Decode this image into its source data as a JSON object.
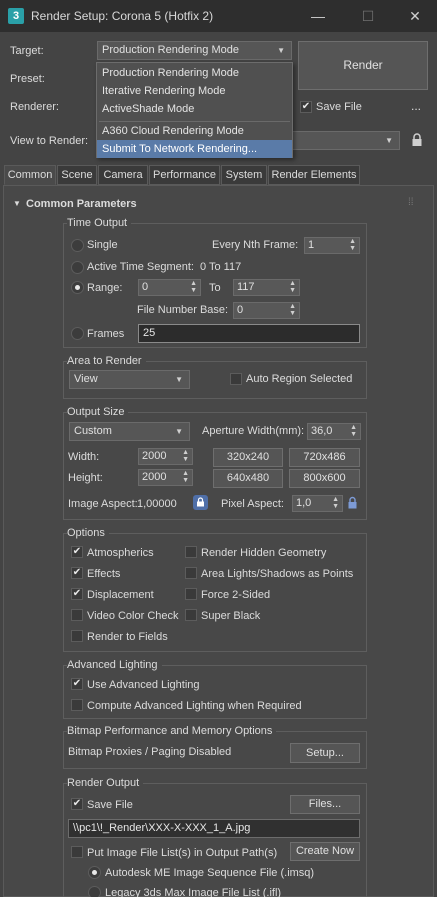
{
  "window": {
    "icon_glyph": "3",
    "title": "Render Setup: Corona 5 (Hotfix 2)",
    "minimize": "—",
    "maximize": "☐",
    "close": "✕"
  },
  "header": {
    "target_label": "Target:",
    "target_value": "Production Rendering Mode",
    "preset_label": "Preset:",
    "renderer_label": "Renderer:",
    "view_label": "View to Render:",
    "render_button": "Render",
    "save_file_label": "Save File",
    "save_file_checked": true,
    "more_label": "..."
  },
  "target_menu": {
    "items": [
      "Production Rendering Mode",
      "Iterative Rendering Mode",
      "ActiveShade Mode",
      "A360 Cloud Rendering Mode",
      "Submit To Network Rendering..."
    ],
    "selected_index": 4
  },
  "tabs": [
    "Common",
    "Scene",
    "Camera",
    "Performance",
    "System",
    "Render Elements"
  ],
  "active_tab": 0,
  "rollout": {
    "title": "Common Parameters",
    "toggle": "▼"
  },
  "time_output": {
    "title": "Time Output",
    "single": "Single",
    "every_nth_label": "Every Nth Frame:",
    "every_nth_value": "1",
    "active_segment": "Active Time Segment:",
    "active_segment_range": "0 To 117",
    "range": "Range:",
    "range_from": "0",
    "range_to_label": "To",
    "range_to": "117",
    "file_number_base_label": "File Number Base:",
    "file_number_base": "0",
    "frames": "Frames",
    "frames_value": "25",
    "selected": "range"
  },
  "area_to_render": {
    "title": "Area to Render",
    "mode": "View",
    "auto_region": "Auto Region Selected",
    "auto_region_checked": false
  },
  "output_size": {
    "title": "Output Size",
    "preset": "Custom",
    "aperture_label": "Aperture Width(mm):",
    "aperture_value": "36,0",
    "width_label": "Width:",
    "width_value": "2000",
    "height_label": "Height:",
    "height_value": "2000",
    "presets": [
      "320x240",
      "720x486",
      "640x480",
      "800x600"
    ],
    "image_aspect_label": "Image Aspect:",
    "image_aspect_value": "1,00000",
    "pixel_aspect_label": "Pixel Aspect:",
    "pixel_aspect_value": "1,0"
  },
  "options": {
    "title": "Options",
    "left": [
      {
        "label": "Atmospherics",
        "checked": true
      },
      {
        "label": "Effects",
        "checked": true
      },
      {
        "label": "Displacement",
        "checked": true
      },
      {
        "label": "Video Color Check",
        "checked": false
      },
      {
        "label": "Render to Fields",
        "checked": false
      }
    ],
    "right": [
      {
        "label": "Render Hidden Geometry",
        "checked": false
      },
      {
        "label": "Area Lights/Shadows as Points",
        "checked": false
      },
      {
        "label": "Force 2-Sided",
        "checked": false
      },
      {
        "label": "Super Black",
        "checked": false
      }
    ]
  },
  "advanced_lighting": {
    "title": "Advanced Lighting",
    "use": "Use Advanced Lighting",
    "use_checked": true,
    "compute": "Compute Advanced Lighting when Required",
    "compute_checked": false
  },
  "bitmap": {
    "title": "Bitmap Performance and Memory Options",
    "status": "Bitmap Proxies / Paging Disabled",
    "setup_button": "Setup..."
  },
  "render_output": {
    "title": "Render Output",
    "save_file": "Save File",
    "save_file_checked": true,
    "files_button": "Files...",
    "path": "\\\\pc1\\!_Render\\XXX-X-XXX_1_A.jpg",
    "put_list": "Put Image File List(s) in Output Path(s)",
    "put_list_checked": false,
    "create_now": "Create Now",
    "autodesk_me": "Autodesk ME Image Sequence File (.imsq)",
    "legacy": "Legacy 3ds Max Image File List (.ifl)"
  },
  "colors": {
    "background": "#444444",
    "titlebar": "#2e2e2e",
    "menu_highlight": "#5a7ba8",
    "lock_blue": "#4f6fa8"
  }
}
